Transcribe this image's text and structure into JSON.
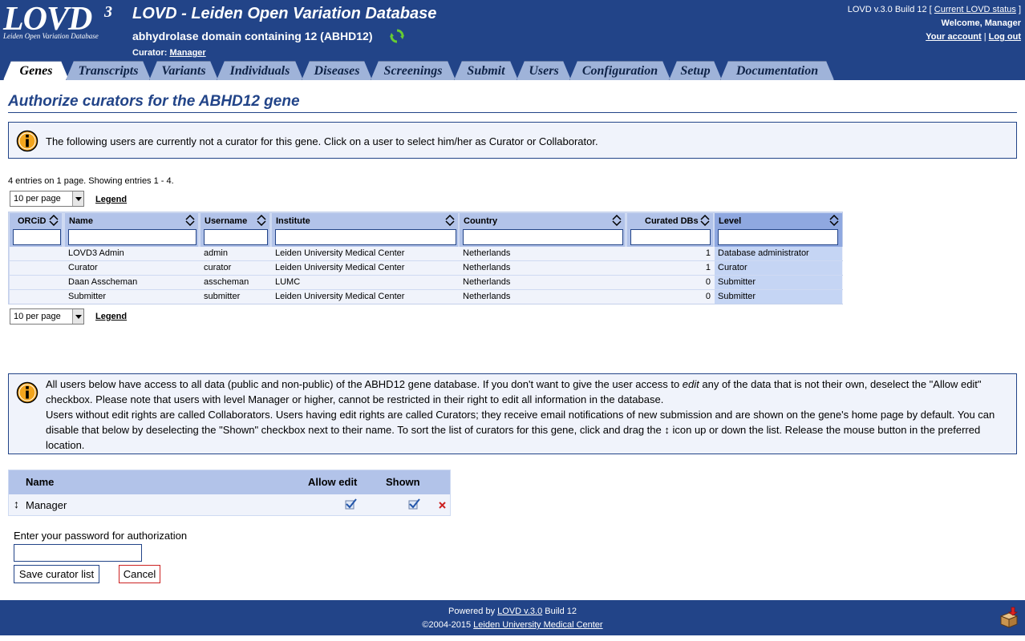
{
  "header": {
    "logo_text": "LOVD",
    "logo_version": "3",
    "logo_subtitle": "Leiden Open Variation Database",
    "site_title": "LOVD - Leiden Open Variation Database",
    "gene_title": "abhydrolase domain containing 12 (ABHD12)",
    "curator_label": "Curator:",
    "curator_name": "Manager",
    "version_text": "LOVD v.3.0 Build 12 [",
    "version_link": "Current LOVD status",
    "version_close": "]",
    "welcome": "Welcome, Manager",
    "account_link": "Your account",
    "separator": "|",
    "logout_link": "Log out"
  },
  "tabs": [
    "Genes",
    "Transcripts",
    "Variants",
    "Individuals",
    "Diseases",
    "Screenings",
    "Submit",
    "Users",
    "Configuration",
    "Setup",
    "Documentation"
  ],
  "active_tab": "Genes",
  "page_title": "Authorize curators for the ABHD12 gene",
  "info1": "The following users are currently not a curator for this gene. Click on a user to select him/her as Curator or Collaborator.",
  "entries_text": "4 entries on 1 page. Showing entries 1 - 4.",
  "per_page": "10 per page",
  "legend": "Legend",
  "table": {
    "columns": [
      "ORCiD",
      "Name",
      "Username",
      "Institute",
      "Country",
      "Curated DBs",
      "Level"
    ],
    "rows": [
      [
        "",
        "LOVD3 Admin",
        "admin",
        "Leiden University Medical Center",
        "Netherlands",
        "1",
        "Database administrator"
      ],
      [
        "",
        "Curator",
        "curator",
        "Leiden University Medical Center",
        "Netherlands",
        "1",
        "Curator"
      ],
      [
        "",
        "Daan Asscheman",
        "asscheman",
        "LUMC",
        "Netherlands",
        "0",
        "Submitter"
      ],
      [
        "",
        "Submitter",
        "submitter",
        "Leiden University Medical Center",
        "Netherlands",
        "0",
        "Submitter"
      ]
    ]
  },
  "info2": {
    "line1_pre": "All users below have access to all data (public and non-public) of the ABHD12 gene database. If you don't want to give the user access to ",
    "line1_em": "edit",
    "line1_post": " any of the data that is not their own, deselect the \"Allow edit\" checkbox. Please note that users with level Manager or higher, cannot be restricted in their right to edit all information in the database.",
    "line2_pre": "Users without edit rights are called Collaborators. Users having edit rights are called Curators; they receive email notifications of new submission and are shown on the gene's home page by default. You can disable that below by deselecting the \"Shown\" checkbox next to their name. To sort the list of curators for this gene, click and drag the ",
    "line2_post": " icon up or down the list. Release the mouse button in the preferred location."
  },
  "curators": {
    "col_name": "Name",
    "col_edit": "Allow edit",
    "col_shown": "Shown",
    "rows": [
      {
        "name": "Manager",
        "allow_edit": true,
        "shown": true
      }
    ]
  },
  "password_label": "Enter your password for authorization",
  "save_button": "Save curator list",
  "cancel_button": "Cancel",
  "footer": {
    "powered_pre": "Powered by ",
    "powered_link": "LOVD v.3.0",
    "powered_post": " Build 12",
    "copy_pre": "©2004-2015 ",
    "copy_link": "Leiden University Medical Center"
  },
  "colors": {
    "brand": "#224488",
    "tab": "#9fb3d9",
    "header_cell": "#b2c3e9",
    "row": "#f0f3fb",
    "level_cell": "#c5d5f4"
  }
}
